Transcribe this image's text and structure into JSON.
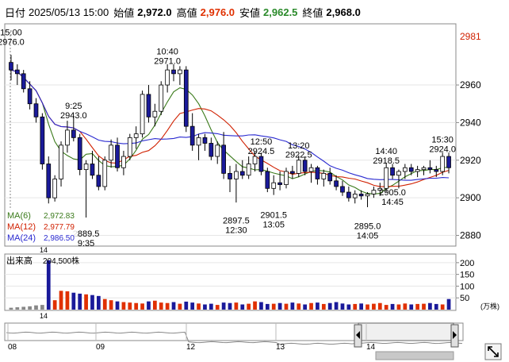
{
  "info": {
    "date_label": "日付",
    "datetime": "2025/05/13 15:00",
    "open_label": "始値",
    "open_value": "2,972.0",
    "high_label": "高値",
    "high_value": "2,976.0",
    "low_label": "安値",
    "low_value": "2,962.5",
    "close_label": "終値",
    "close_value": "2,968.0",
    "colors": {
      "up": "#e03000",
      "down": "#2a8a2a",
      "text": "#000000"
    }
  },
  "chart_data": [
    {
      "type": "candlestick",
      "interval": "5min",
      "ylim": [
        2876,
        2990
      ],
      "yticks": [
        2880,
        2900,
        2920,
        2940,
        2960
      ],
      "last_price_label": "2981",
      "x_session_label": "14",
      "candles": [
        {
          "o": 2972.0,
          "h": 2976.0,
          "l": 2962.5,
          "c": 2968.0
        },
        {
          "o": 2968.0,
          "h": 2971.0,
          "l": 2960.0,
          "c": 2966.0
        },
        {
          "o": 2966.0,
          "h": 2968.0,
          "l": 2956.0,
          "c": 2958.0
        },
        {
          "o": 2958.0,
          "h": 2962.0,
          "l": 2947.0,
          "c": 2950.0
        },
        {
          "o": 2950.0,
          "h": 2953.0,
          "l": 2940.0,
          "c": 2943.0
        },
        {
          "o": 2943.0,
          "h": 2945.0,
          "l": 2915.0,
          "c": 2918.0
        },
        {
          "o": 2918.0,
          "h": 2922.0,
          "l": 2897.0,
          "c": 2900.0
        },
        {
          "o": 2900.0,
          "h": 2912.0,
          "l": 2898.0,
          "c": 2910.0
        },
        {
          "o": 2910.0,
          "h": 2930.0,
          "l": 2906.0,
          "c": 2928.0
        },
        {
          "o": 2928.0,
          "h": 2941.0,
          "l": 2924.0,
          "c": 2936.0
        },
        {
          "o": 2936.0,
          "h": 2943.0,
          "l": 2930.0,
          "c": 2932.0
        },
        {
          "o": 2932.0,
          "h": 2934.0,
          "l": 2912.0,
          "c": 2915.0
        },
        {
          "o": 2915.0,
          "h": 2920.0,
          "l": 2889.5,
          "c": 2918.0
        },
        {
          "o": 2918.0,
          "h": 2925.0,
          "l": 2910.0,
          "c": 2912.0
        },
        {
          "o": 2912.0,
          "h": 2922.0,
          "l": 2904.0,
          "c": 2906.0
        },
        {
          "o": 2906.0,
          "h": 2922.0,
          "l": 2904.0,
          "c": 2920.0
        },
        {
          "o": 2920.0,
          "h": 2931.0,
          "l": 2916.0,
          "c": 2928.0
        },
        {
          "o": 2928.0,
          "h": 2932.0,
          "l": 2914.0,
          "c": 2916.0
        },
        {
          "o": 2916.0,
          "h": 2925.0,
          "l": 2912.0,
          "c": 2922.0
        },
        {
          "o": 2922.0,
          "h": 2934.0,
          "l": 2920.0,
          "c": 2932.0
        },
        {
          "o": 2932.0,
          "h": 2938.0,
          "l": 2926.0,
          "c": 2934.0
        },
        {
          "o": 2934.0,
          "h": 2957.0,
          "l": 2932.0,
          "c": 2955.0
        },
        {
          "o": 2955.0,
          "h": 2960.0,
          "l": 2940.0,
          "c": 2943.0
        },
        {
          "o": 2943.0,
          "h": 2950.0,
          "l": 2938.0,
          "c": 2946.0
        },
        {
          "o": 2946.0,
          "h": 2962.0,
          "l": 2944.0,
          "c": 2960.0
        },
        {
          "o": 2960.0,
          "h": 2971.0,
          "l": 2956.0,
          "c": 2968.0
        },
        {
          "o": 2968.0,
          "h": 2971.0,
          "l": 2962.0,
          "c": 2966.0
        },
        {
          "o": 2966.0,
          "h": 2970.0,
          "l": 2960.0,
          "c": 2968.0
        },
        {
          "o": 2968.0,
          "h": 2970.0,
          "l": 2935.0,
          "c": 2938.0
        },
        {
          "o": 2938.0,
          "h": 2945.0,
          "l": 2925.0,
          "c": 2928.0
        },
        {
          "o": 2928.0,
          "h": 2934.0,
          "l": 2920.0,
          "c": 2932.0
        },
        {
          "o": 2932.0,
          "h": 2934.0,
          "l": 2925.0,
          "c": 2929.0
        },
        {
          "o": 2929.0,
          "h": 2932.0,
          "l": 2920.0,
          "c": 2922.0
        },
        {
          "o": 2922.0,
          "h": 2930.0,
          "l": 2918.0,
          "c": 2928.0
        },
        {
          "o": 2928.0,
          "h": 2935.0,
          "l": 2910.0,
          "c": 2913.0
        },
        {
          "o": 2913.0,
          "h": 2917.0,
          "l": 2903.0,
          "c": 2910.0
        },
        {
          "o": 2910.0,
          "h": 2918.0,
          "l": 2897.5,
          "c": 2914.0
        },
        {
          "o": 2914.0,
          "h": 2920.0,
          "l": 2910.0,
          "c": 2912.0
        },
        {
          "o": 2912.0,
          "h": 2922.0,
          "l": 2910.0,
          "c": 2918.0
        },
        {
          "o": 2918.0,
          "h": 2924.5,
          "l": 2914.0,
          "c": 2922.0
        },
        {
          "o": 2922.0,
          "h": 2924.0,
          "l": 2912.0,
          "c": 2914.0
        },
        {
          "o": 2914.0,
          "h": 2916.0,
          "l": 2903.0,
          "c": 2905.0
        },
        {
          "o": 2905.0,
          "h": 2912.0,
          "l": 2901.5,
          "c": 2908.0
        },
        {
          "o": 2908.0,
          "h": 2914.0,
          "l": 2904.0,
          "c": 2907.0
        },
        {
          "o": 2907.0,
          "h": 2916.0,
          "l": 2905.0,
          "c": 2914.0
        },
        {
          "o": 2914.0,
          "h": 2917.0,
          "l": 2910.0,
          "c": 2913.0
        },
        {
          "o": 2913.0,
          "h": 2922.5,
          "l": 2911.0,
          "c": 2920.0
        },
        {
          "o": 2920.0,
          "h": 2922.0,
          "l": 2912.0,
          "c": 2914.0
        },
        {
          "o": 2914.0,
          "h": 2918.0,
          "l": 2908.0,
          "c": 2916.0
        },
        {
          "o": 2916.0,
          "h": 2917.0,
          "l": 2907.0,
          "c": 2910.0
        },
        {
          "o": 2910.0,
          "h": 2915.0,
          "l": 2906.0,
          "c": 2913.0
        },
        {
          "o": 2913.0,
          "h": 2916.0,
          "l": 2907.0,
          "c": 2909.0
        },
        {
          "o": 2909.0,
          "h": 2912.0,
          "l": 2904.0,
          "c": 2906.0
        },
        {
          "o": 2906.0,
          "h": 2909.0,
          "l": 2901.0,
          "c": 2903.0
        },
        {
          "o": 2903.0,
          "h": 2906.0,
          "l": 2898.0,
          "c": 2900.0
        },
        {
          "o": 2900.0,
          "h": 2904.0,
          "l": 2897.0,
          "c": 2902.0
        },
        {
          "o": 2902.0,
          "h": 2904.0,
          "l": 2899.0,
          "c": 2901.0
        },
        {
          "o": 2901.0,
          "h": 2903.0,
          "l": 2895.0,
          "c": 2902.0
        },
        {
          "o": 2902.0,
          "h": 2906.0,
          "l": 2900.0,
          "c": 2904.0
        },
        {
          "o": 2904.0,
          "h": 2908.0,
          "l": 2901.0,
          "c": 2905.0
        },
        {
          "o": 2905.0,
          "h": 2918.5,
          "l": 2903.0,
          "c": 2916.0
        },
        {
          "o": 2916.0,
          "h": 2918.0,
          "l": 2910.0,
          "c": 2912.0
        },
        {
          "o": 2912.0,
          "h": 2915.0,
          "l": 2905.0,
          "c": 2914.0
        },
        {
          "o": 2914.0,
          "h": 2918.0,
          "l": 2910.0,
          "c": 2916.0
        },
        {
          "o": 2916.0,
          "h": 2918.0,
          "l": 2912.0,
          "c": 2914.0
        },
        {
          "o": 2914.0,
          "h": 2917.0,
          "l": 2911.0,
          "c": 2915.0
        },
        {
          "o": 2915.0,
          "h": 2917.0,
          "l": 2912.0,
          "c": 2916.0
        },
        {
          "o": 2916.0,
          "h": 2920.0,
          "l": 2913.0,
          "c": 2915.0
        },
        {
          "o": 2915.0,
          "h": 2917.0,
          "l": 2911.0,
          "c": 2914.0
        },
        {
          "o": 2914.0,
          "h": 2924.0,
          "l": 2912.0,
          "c": 2922.0
        },
        {
          "o": 2922.0,
          "h": 2924.0,
          "l": 2913.0,
          "c": 2916.0
        }
      ],
      "annotations": [
        {
          "text": "15:00",
          "y": 2988,
          "i": 0
        },
        {
          "text": "2976.0",
          "y": 2983,
          "i": 0
        },
        {
          "text": "9:25",
          "y": 2949,
          "i": 10
        },
        {
          "text": "2943.0",
          "y": 2944,
          "i": 10
        },
        {
          "text": "10:40",
          "y": 2978,
          "i": 25
        },
        {
          "text": "2971.0",
          "y": 2973,
          "i": 25
        },
        {
          "text": "12:50",
          "y": 2930,
          "i": 40
        },
        {
          "text": "2924.5",
          "y": 2925,
          "i": 40
        },
        {
          "text": "13:20",
          "y": 2928,
          "i": 46
        },
        {
          "text": "2922.5",
          "y": 2923,
          "i": 46
        },
        {
          "text": "14:40",
          "y": 2925,
          "i": 60
        },
        {
          "text": "2918.5",
          "y": 2920,
          "i": 60
        },
        {
          "text": "15:30",
          "y": 2931,
          "i": 69
        },
        {
          "text": "2924.0",
          "y": 2926,
          "i": 69
        },
        {
          "text": "2889.5",
          "y": 2881,
          "i": 12
        },
        {
          "text": "9:35",
          "y": 2876,
          "i": 12
        },
        {
          "text": "2897.5",
          "y": 2888,
          "i": 36
        },
        {
          "text": "12:30",
          "y": 2883,
          "i": 36
        },
        {
          "text": "2901.5",
          "y": 2891,
          "i": 42
        },
        {
          "text": "13:05",
          "y": 2886,
          "i": 42
        },
        {
          "text": "2895.0",
          "y": 2885,
          "i": 57
        },
        {
          "text": "14:05",
          "y": 2880,
          "i": 57
        },
        {
          "text": "2905.0",
          "y": 2903,
          "i": 61
        },
        {
          "text": "14:45",
          "y": 2898,
          "i": 61
        }
      ],
      "ma_legend": [
        {
          "label": "MA(6)",
          "value": "2,972.83",
          "color": "#3a7a1a"
        },
        {
          "label": "MA(12)",
          "value": "2,977.79",
          "color": "#d02000"
        },
        {
          "label": "MA(24)",
          "value": "2,986.50",
          "color": "#2a2ad0"
        }
      ],
      "colors": {
        "candle_down": "#1a1a9a",
        "candle_up": "#ffffff",
        "ma6": "#3a7a1a",
        "ma12": "#d02000",
        "ma24": "#2a2ad0"
      }
    },
    {
      "type": "bar",
      "title": "出来高",
      "title_value": "204,500株",
      "unit": "(万株)",
      "yticks": [
        50,
        100,
        150,
        200
      ],
      "ylim": [
        0,
        230
      ],
      "x_session_label": "14",
      "values": [
        8,
        10,
        12,
        14,
        18,
        20,
        210,
        40,
        80,
        78,
        72,
        68,
        65,
        62,
        58,
        45,
        40,
        35,
        32,
        30,
        28,
        26,
        35,
        38,
        30,
        28,
        32,
        25,
        34,
        30,
        26,
        22,
        25,
        20,
        30,
        28,
        30,
        22,
        25,
        35,
        32,
        24,
        25,
        28,
        25,
        30,
        26,
        22,
        28,
        30,
        24,
        28,
        32,
        26,
        22,
        24,
        26,
        22,
        25,
        28,
        20,
        24,
        22,
        26,
        22,
        24,
        25,
        28,
        24,
        22,
        45
      ],
      "colors": {
        "up": "#e03000",
        "down": "#1a1a9a",
        "neutral": "#888888"
      }
    },
    {
      "type": "area",
      "x_labels": [
        "08",
        "09",
        "12",
        "13",
        "14"
      ],
      "colors": {
        "line": "#888888"
      }
    }
  ]
}
